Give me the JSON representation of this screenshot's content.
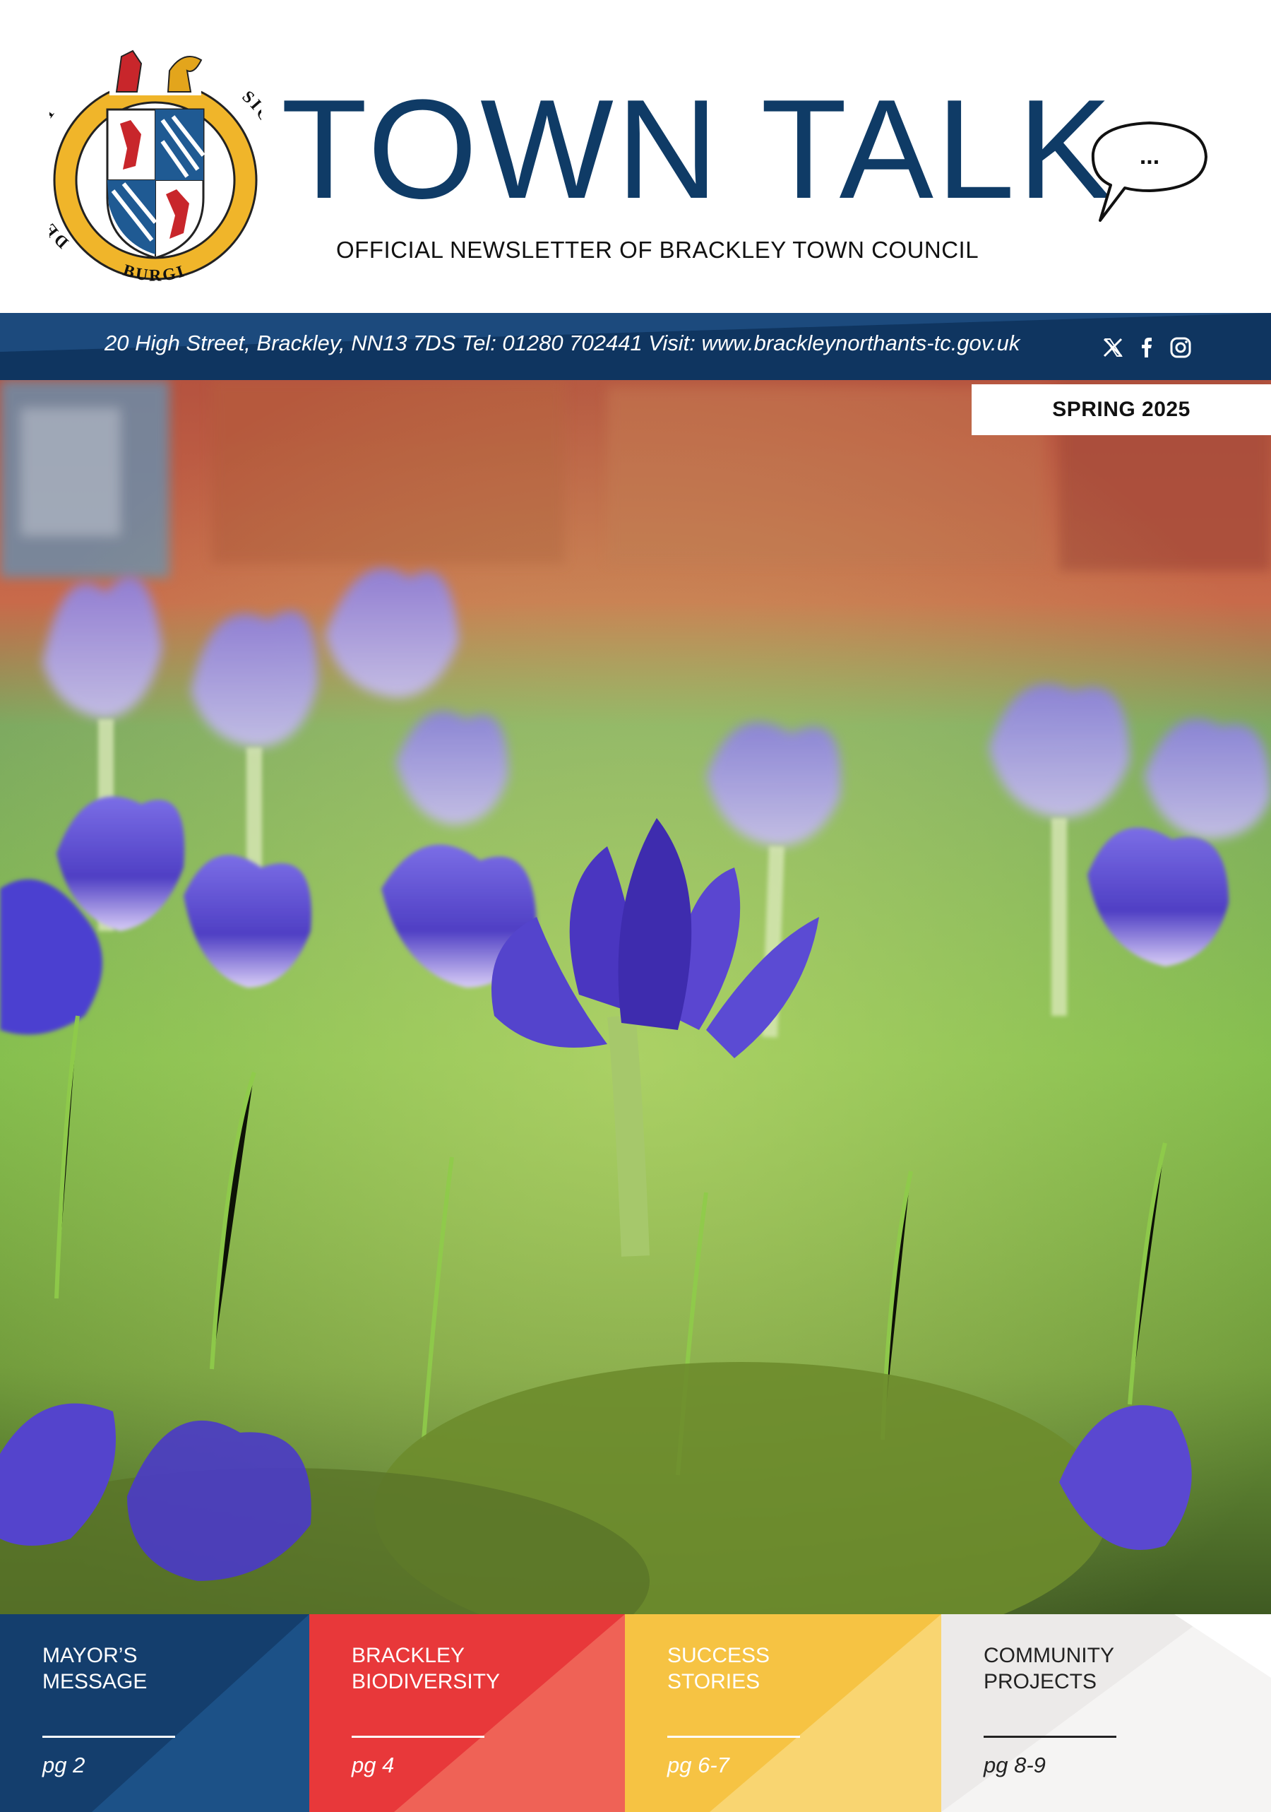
{
  "header": {
    "title": "TOWN TALK",
    "subtitle": "OFFICIAL NEWSLETTER OF BRACKLEY TOWN COUNCIL",
    "crest_text_left": "DE BRACKLEY",
    "crest_text_right": "SIGILLUM",
    "crest_text_bottom": "BURGI",
    "bubble_text": "..."
  },
  "contact": {
    "text": "20 High Street, Brackley, NN13 7DS Tel: 01280 702441 Visit: www.brackleynorthants-tc.gov.uk",
    "icons": [
      "x-icon",
      "facebook-icon",
      "instagram-icon"
    ]
  },
  "issue": {
    "season": "SPRING 2025"
  },
  "tiles": [
    {
      "label": "MAYOR’S\nMESSAGE",
      "page": "pg 2",
      "color": "#143e6d"
    },
    {
      "label": "BRACKLEY\nBIODIVERSITY",
      "page": "pg 4",
      "color": "#e8383a"
    },
    {
      "label": "SUCCESS\nSTORIES",
      "page": "pg 6-7",
      "color": "#f6c343"
    },
    {
      "label": "COMMUNITY\nPROJECTS",
      "page": "pg 8-9",
      "color": "#eceae9"
    }
  ],
  "colors": {
    "navy": "#0f3b66",
    "gold": "#e3a51c",
    "red": "#c8262b"
  }
}
